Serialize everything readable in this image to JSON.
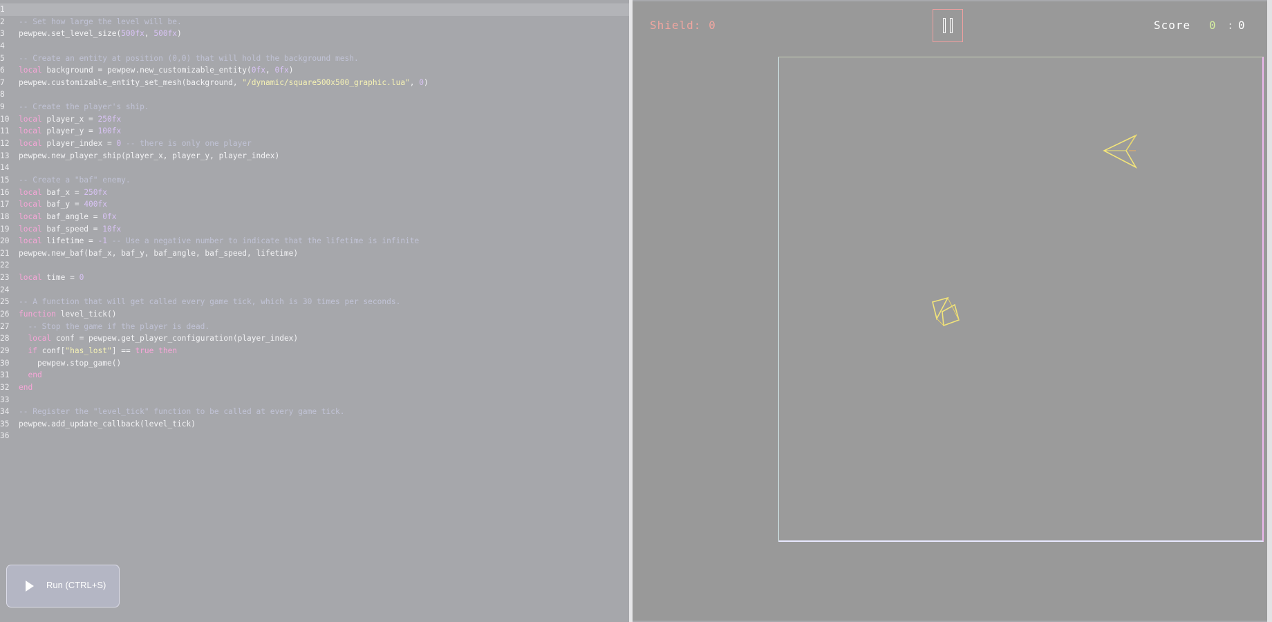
{
  "editor": {
    "lines": [
      {
        "n": "1",
        "active": true,
        "tokens": []
      },
      {
        "n": "2",
        "tokens": [
          [
            "cmt",
            "-- Set how large the level will be."
          ]
        ]
      },
      {
        "n": "3",
        "tokens": [
          [
            "plain",
            "pewpew.set_level_size("
          ],
          [
            "num",
            "500fx"
          ],
          [
            "plain",
            ", "
          ],
          [
            "num",
            "500fx"
          ],
          [
            "plain",
            ")"
          ]
        ]
      },
      {
        "n": "4",
        "tokens": []
      },
      {
        "n": "5",
        "tokens": [
          [
            "cmt",
            "-- Create an entity at position (0,0) that will hold the background mesh."
          ]
        ]
      },
      {
        "n": "6",
        "tokens": [
          [
            "kw",
            "local"
          ],
          [
            "plain",
            " background = pewpew.new_customizable_entity("
          ],
          [
            "num",
            "0fx"
          ],
          [
            "plain",
            ", "
          ],
          [
            "num",
            "0fx"
          ],
          [
            "plain",
            ")"
          ]
        ]
      },
      {
        "n": "7",
        "tokens": [
          [
            "plain",
            "pewpew.customizable_entity_set_mesh(background, "
          ],
          [
            "str",
            "\"/dynamic/square500x500_graphic.lua\""
          ],
          [
            "plain",
            ", "
          ],
          [
            "num",
            "0"
          ],
          [
            "plain",
            ")"
          ]
        ]
      },
      {
        "n": "8",
        "tokens": []
      },
      {
        "n": "9",
        "tokens": [
          [
            "cmt",
            "-- Create the player's ship."
          ]
        ]
      },
      {
        "n": "10",
        "tokens": [
          [
            "kw",
            "local"
          ],
          [
            "plain",
            " player_x = "
          ],
          [
            "num",
            "250fx"
          ]
        ]
      },
      {
        "n": "11",
        "tokens": [
          [
            "kw",
            "local"
          ],
          [
            "plain",
            " player_y = "
          ],
          [
            "num",
            "100fx"
          ]
        ]
      },
      {
        "n": "12",
        "tokens": [
          [
            "kw",
            "local"
          ],
          [
            "plain",
            " player_index = "
          ],
          [
            "num",
            "0"
          ],
          [
            "cmt",
            " -- there is only one player"
          ]
        ]
      },
      {
        "n": "13",
        "tokens": [
          [
            "plain",
            "pewpew.new_player_ship(player_x, player_y, player_index)"
          ]
        ]
      },
      {
        "n": "14",
        "tokens": []
      },
      {
        "n": "15",
        "tokens": [
          [
            "cmt",
            "-- Create a \"baf\" enemy."
          ]
        ]
      },
      {
        "n": "16",
        "tokens": [
          [
            "kw",
            "local"
          ],
          [
            "plain",
            " baf_x = "
          ],
          [
            "num",
            "250fx"
          ]
        ]
      },
      {
        "n": "17",
        "tokens": [
          [
            "kw",
            "local"
          ],
          [
            "plain",
            " baf_y = "
          ],
          [
            "num",
            "400fx"
          ]
        ]
      },
      {
        "n": "18",
        "tokens": [
          [
            "kw",
            "local"
          ],
          [
            "plain",
            " baf_angle = "
          ],
          [
            "num",
            "0fx"
          ]
        ]
      },
      {
        "n": "19",
        "tokens": [
          [
            "kw",
            "local"
          ],
          [
            "plain",
            " baf_speed = "
          ],
          [
            "num",
            "10fx"
          ]
        ]
      },
      {
        "n": "20",
        "tokens": [
          [
            "kw",
            "local"
          ],
          [
            "plain",
            " lifetime = "
          ],
          [
            "num",
            "-1"
          ],
          [
            "cmt",
            " -- Use a negative number to indicate that the lifetime is infinite"
          ]
        ]
      },
      {
        "n": "21",
        "tokens": [
          [
            "plain",
            "pewpew.new_baf(baf_x, baf_y, baf_angle, baf_speed, lifetime)"
          ]
        ]
      },
      {
        "n": "22",
        "tokens": []
      },
      {
        "n": "23",
        "tokens": [
          [
            "kw",
            "local"
          ],
          [
            "plain",
            " time = "
          ],
          [
            "num",
            "0"
          ]
        ]
      },
      {
        "n": "24",
        "tokens": []
      },
      {
        "n": "25",
        "tokens": [
          [
            "cmt",
            "-- A function that will get called every game tick, which is 30 times per seconds."
          ]
        ]
      },
      {
        "n": "26",
        "tokens": [
          [
            "kw",
            "function"
          ],
          [
            "plain",
            " level_tick()"
          ]
        ]
      },
      {
        "n": "27",
        "tokens": [
          [
            "cmt",
            "  -- Stop the game if the player is dead."
          ]
        ]
      },
      {
        "n": "28",
        "tokens": [
          [
            "plain",
            "  "
          ],
          [
            "kw",
            "local"
          ],
          [
            "plain",
            " conf = pewpew.get_player_configuration(player_index)"
          ]
        ]
      },
      {
        "n": "29",
        "tokens": [
          [
            "plain",
            "  "
          ],
          [
            "kw",
            "if"
          ],
          [
            "plain",
            " conf["
          ],
          [
            "str",
            "\"has_lost\""
          ],
          [
            "plain",
            "] == "
          ],
          [
            "kw",
            "true"
          ],
          [
            "plain",
            " "
          ],
          [
            "kw",
            "then"
          ]
        ]
      },
      {
        "n": "30",
        "tokens": [
          [
            "plain",
            "    pewpew.stop_game()"
          ]
        ]
      },
      {
        "n": "31",
        "tokens": [
          [
            "plain",
            "  "
          ],
          [
            "kw",
            "end"
          ]
        ]
      },
      {
        "n": "32",
        "tokens": [
          [
            "kw",
            "end"
          ]
        ]
      },
      {
        "n": "33",
        "tokens": []
      },
      {
        "n": "34",
        "tokens": [
          [
            "cmt",
            "-- Register the \"level_tick\" function to be called at every game tick."
          ]
        ]
      },
      {
        "n": "35",
        "tokens": [
          [
            "plain",
            "pewpew.add_update_callback(level_tick)"
          ]
        ]
      },
      {
        "n": "36",
        "tokens": []
      }
    ],
    "run_label": "Run (CTRL+S)",
    "run_icon": "play-icon"
  },
  "game": {
    "shield_text": "Shield: 0",
    "score_label": "Score",
    "score_left": "0",
    "score_sep": ":",
    "score_right": "0",
    "pause_icon": "pause-icon",
    "colors": {
      "shield": "#f0a6a0",
      "ship": "#f2e47a",
      "baf": "#f2e47a",
      "pause_border": "#f0a0a0"
    }
  }
}
